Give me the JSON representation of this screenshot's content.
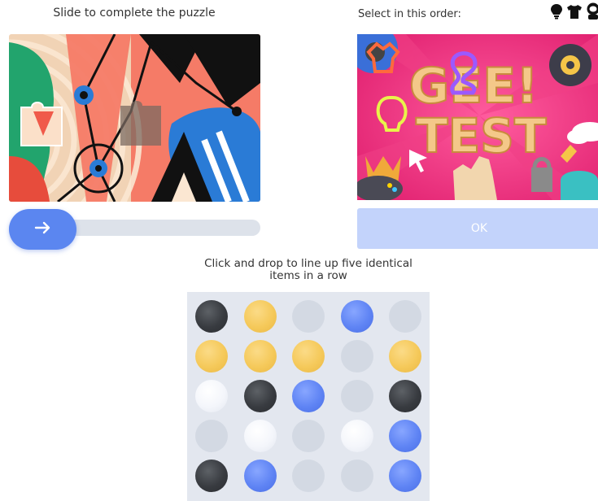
{
  "slider_puzzle": {
    "title": "Slide to complete the puzzle",
    "handle_icon": "arrow-right-icon"
  },
  "select_order": {
    "title": "Select in this order:",
    "order_icons": [
      "lightbulb-icon",
      "tshirt-icon",
      "astronaut-helmet-icon"
    ],
    "image_text": "GEE! TEST",
    "ok_label": "OK"
  },
  "five_in_row": {
    "title_line1": "Click and drop to line up five identical",
    "title_line2": "items in a row",
    "grid": [
      [
        "dark",
        "yellow",
        "empty",
        "blue",
        "empty"
      ],
      [
        "yellow",
        "yellow",
        "yellow",
        "empty",
        "yellow"
      ],
      [
        "white",
        "dark",
        "blue",
        "empty",
        "dark"
      ],
      [
        "empty",
        "white",
        "empty",
        "white",
        "blue"
      ],
      [
        "dark",
        "blue",
        "empty",
        "empty",
        "blue"
      ]
    ]
  },
  "colors": {
    "accent": "#5b86f0",
    "ok_disabled": "#c3d3fb",
    "track": "#dde2ea",
    "grid_bg": "#e3e7ef"
  }
}
